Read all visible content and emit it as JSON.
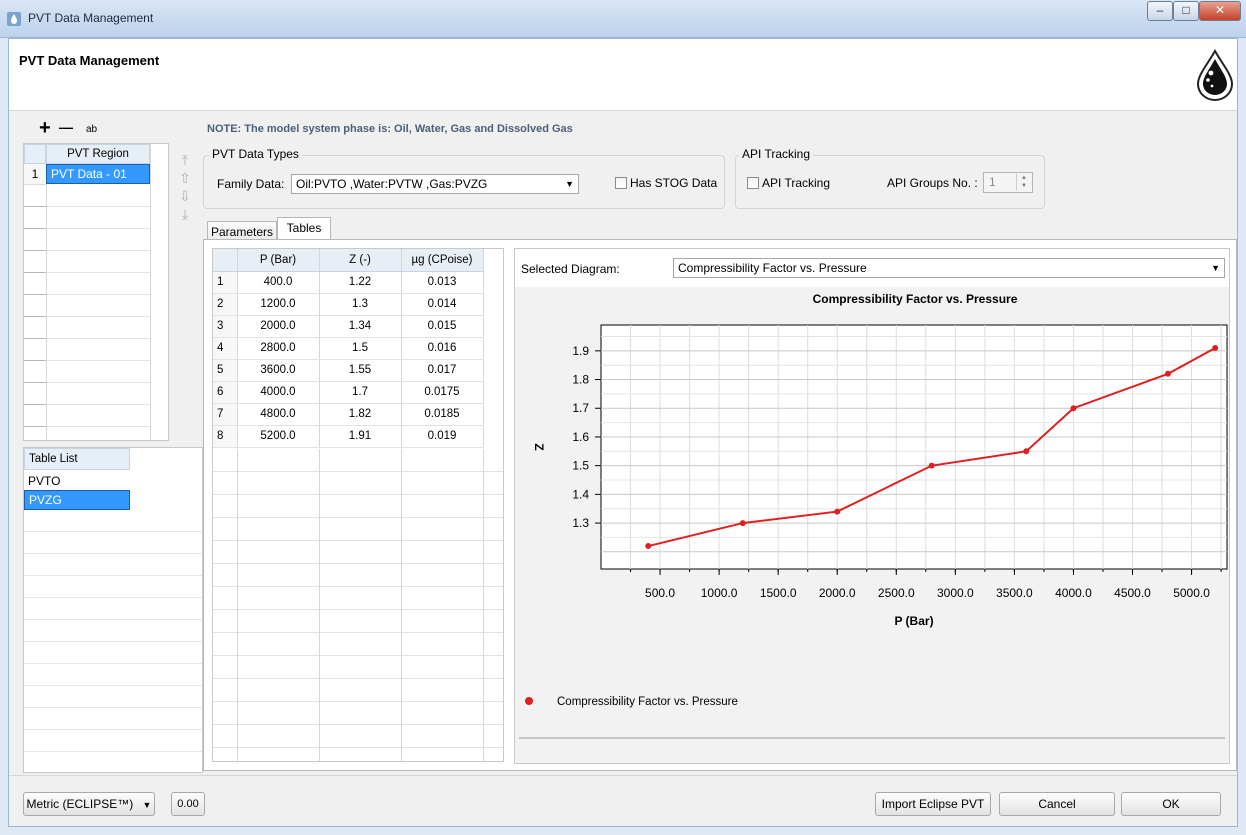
{
  "window": {
    "title": "PVT Data Management",
    "controls": [
      "minimize-icon",
      "maximize-icon",
      "close-icon"
    ]
  },
  "header": {
    "title": "PVT Data Management",
    "logo_icon": "oil-drop-icon"
  },
  "region_toolbar": {
    "add": "+",
    "remove": "—",
    "rename": "ab"
  },
  "regions": {
    "header": "PVT Region",
    "rows": [
      {
        "index": "1",
        "name": "PVT Data - 01"
      }
    ]
  },
  "table_list": {
    "header": "Table List",
    "items": [
      "PVTO",
      "PVZG"
    ],
    "selected": "PVZG"
  },
  "note": "NOTE: The model system phase is: Oil, Water, Gas and Dissolved Gas",
  "pvt_types": {
    "group_label": "PVT Data Types",
    "family_label": "Family Data:",
    "family_value": "Oil:PVTO ,Water:PVTW ,Gas:PVZG",
    "stog_label": "Has STOG Data",
    "stog_checked": false
  },
  "api": {
    "group_label": "API Tracking",
    "checkbox_label": "API Tracking",
    "checked": false,
    "groups_label": "API Groups No. :",
    "groups_value": "1"
  },
  "tabs": [
    {
      "label": "Parameters",
      "active": false
    },
    {
      "label": "Tables",
      "active": true
    }
  ],
  "table": {
    "columns": [
      "P (Bar)",
      "Z (-)",
      "µg (CPoise)"
    ],
    "rows": [
      [
        "1",
        "400.0",
        "1.22",
        "0.013"
      ],
      [
        "2",
        "1200.0",
        "1.3",
        "0.014"
      ],
      [
        "3",
        "2000.0",
        "1.34",
        "0.015"
      ],
      [
        "4",
        "2800.0",
        "1.5",
        "0.016"
      ],
      [
        "5",
        "3600.0",
        "1.55",
        "0.017"
      ],
      [
        "6",
        "4000.0",
        "1.7",
        "0.0175"
      ],
      [
        "7",
        "4800.0",
        "1.82",
        "0.0185"
      ],
      [
        "8",
        "5200.0",
        "1.91",
        "0.019"
      ]
    ]
  },
  "diagram": {
    "selected_label": "Selected Diagram:",
    "selected_value": "Compressibility Factor vs. Pressure"
  },
  "chart_data": {
    "type": "line",
    "title": "Compressibility Factor vs. Pressure",
    "xlabel": "P (Bar)",
    "ylabel": "Z",
    "x": [
      400,
      1200,
      2000,
      2800,
      3600,
      4000,
      4800,
      5200
    ],
    "series": [
      {
        "name": "Compressibility Factor vs. Pressure",
        "values": [
          1.22,
          1.3,
          1.34,
          1.5,
          1.55,
          1.7,
          1.82,
          1.91
        ],
        "color": "#e02020"
      }
    ],
    "xticks": [
      "500.0",
      "1000.0",
      "1500.0",
      "2000.0",
      "2500.0",
      "3000.0",
      "3500.0",
      "4000.0",
      "4500.0",
      "5000.0"
    ],
    "yticks": [
      "1.3",
      "1.4",
      "1.5",
      "1.6",
      "1.7",
      "1.8",
      "1.9"
    ],
    "xlim": [
      0,
      5300
    ],
    "ylim": [
      1.14,
      1.99
    ],
    "grid": true,
    "legend": "bottom-left"
  },
  "footer": {
    "unit_system": "Metric (ECLIPSE™)",
    "precision": "0.00",
    "import_label": "Import Eclipse PVT",
    "cancel_label": "Cancel",
    "ok_label": "OK"
  }
}
